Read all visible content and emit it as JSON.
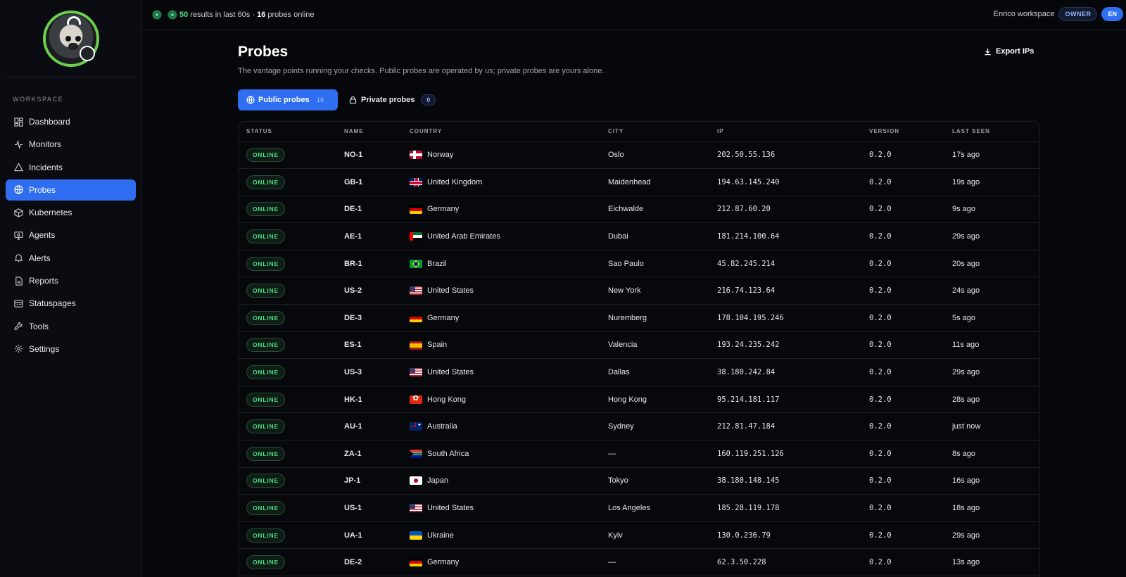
{
  "topbar": {
    "status_num": "50",
    "status_mid": " results in last 60s · ",
    "probes_num": "16",
    "status_end": " probes online",
    "workspace": "Enrico workspace",
    "role_badge": "OWNER",
    "lang_badge": "EN"
  },
  "sidebar": {
    "section_label": "WORKSPACE",
    "items": [
      {
        "label": "Dashboard",
        "icon": "dashboard-icon"
      },
      {
        "label": "Monitors",
        "icon": "activity-icon"
      },
      {
        "label": "Incidents",
        "icon": "warning-icon"
      },
      {
        "label": "Probes",
        "icon": "globe-icon",
        "active": true
      },
      {
        "label": "Kubernetes",
        "icon": "cube-icon"
      },
      {
        "label": "Agents",
        "icon": "agent-icon"
      },
      {
        "label": "Alerts",
        "icon": "bell-icon"
      },
      {
        "label": "Reports",
        "icon": "report-icon"
      },
      {
        "label": "Statuspages",
        "icon": "statuspage-icon"
      },
      {
        "label": "Tools",
        "icon": "wrench-icon"
      },
      {
        "label": "Settings",
        "icon": "gear-icon"
      }
    ]
  },
  "page": {
    "title": "Probes",
    "subtitle": "The vantage points running your checks. Public probes are operated by us; private probes are yours alone.",
    "export_label": "Export IPs"
  },
  "tabs": {
    "public_label": "Public probes",
    "public_count": "16",
    "private_label": "Private probes",
    "private_count": "0"
  },
  "table": {
    "headers": [
      "STATUS",
      "NAME",
      "COUNTRY",
      "CITY",
      "IP",
      "VERSION",
      "LAST SEEN"
    ],
    "rows": [
      {
        "status": "ONLINE",
        "name": "NO-1",
        "cc": "NO",
        "country": "Norway",
        "city": "Oslo",
        "ip": "202.50.55.136",
        "version": "0.2.0",
        "last_seen": "17s ago"
      },
      {
        "status": "ONLINE",
        "name": "GB-1",
        "cc": "GB",
        "country": "United Kingdom",
        "city": "Maidenhead",
        "ip": "194.63.145.240",
        "version": "0.2.0",
        "last_seen": "19s ago"
      },
      {
        "status": "ONLINE",
        "name": "DE-1",
        "cc": "DE",
        "country": "Germany",
        "city": "Eichwalde",
        "ip": "212.87.60.20",
        "version": "0.2.0",
        "last_seen": "9s ago"
      },
      {
        "status": "ONLINE",
        "name": "AE-1",
        "cc": "AE",
        "country": "United Arab Emirates",
        "city": "Dubai",
        "ip": "181.214.100.64",
        "version": "0.2.0",
        "last_seen": "29s ago"
      },
      {
        "status": "ONLINE",
        "name": "BR-1",
        "cc": "BR",
        "country": "Brazil",
        "city": "Sao Paulo",
        "ip": "45.82.245.214",
        "version": "0.2.0",
        "last_seen": "20s ago"
      },
      {
        "status": "ONLINE",
        "name": "US-2",
        "cc": "US",
        "country": "United States",
        "city": "New York",
        "ip": "216.74.123.64",
        "version": "0.2.0",
        "last_seen": "24s ago"
      },
      {
        "status": "ONLINE",
        "name": "DE-3",
        "cc": "DE",
        "country": "Germany",
        "city": "Nuremberg",
        "ip": "178.104.195.246",
        "version": "0.2.0",
        "last_seen": "5s ago"
      },
      {
        "status": "ONLINE",
        "name": "ES-1",
        "cc": "ES",
        "country": "Spain",
        "city": "Valencia",
        "ip": "193.24.235.242",
        "version": "0.2.0",
        "last_seen": "11s ago"
      },
      {
        "status": "ONLINE",
        "name": "US-3",
        "cc": "US",
        "country": "United States",
        "city": "Dallas",
        "ip": "38.180.242.84",
        "version": "0.2.0",
        "last_seen": "29s ago"
      },
      {
        "status": "ONLINE",
        "name": "HK-1",
        "cc": "HK",
        "country": "Hong Kong",
        "city": "Hong Kong",
        "ip": "95.214.181.117",
        "version": "0.2.0",
        "last_seen": "28s ago"
      },
      {
        "status": "ONLINE",
        "name": "AU-1",
        "cc": "AU",
        "country": "Australia",
        "city": "Sydney",
        "ip": "212.81.47.184",
        "version": "0.2.0",
        "last_seen": "just now"
      },
      {
        "status": "ONLINE",
        "name": "ZA-1",
        "cc": "ZA",
        "country": "South Africa",
        "city": "—",
        "ip": "160.119.251.126",
        "version": "0.2.0",
        "last_seen": "8s ago"
      },
      {
        "status": "ONLINE",
        "name": "JP-1",
        "cc": "JP",
        "country": "Japan",
        "city": "Tokyo",
        "ip": "38.180.148.145",
        "version": "0.2.0",
        "last_seen": "16s ago"
      },
      {
        "status": "ONLINE",
        "name": "US-1",
        "cc": "US",
        "country": "United States",
        "city": "Los Angeles",
        "ip": "185.28.119.178",
        "version": "0.2.0",
        "last_seen": "18s ago"
      },
      {
        "status": "ONLINE",
        "name": "UA-1",
        "cc": "UA",
        "country": "Ukraine",
        "city": "Kyiv",
        "ip": "130.0.236.79",
        "version": "0.2.0",
        "last_seen": "29s ago"
      },
      {
        "status": "ONLINE",
        "name": "DE-2",
        "cc": "DE",
        "country": "Germany",
        "city": "—",
        "ip": "62.3.50.228",
        "version": "0.2.0",
        "last_seen": "13s ago"
      }
    ]
  },
  "colors": {
    "accent": "#2f6ef0",
    "online": "#4ade80",
    "background": "#06070a"
  }
}
